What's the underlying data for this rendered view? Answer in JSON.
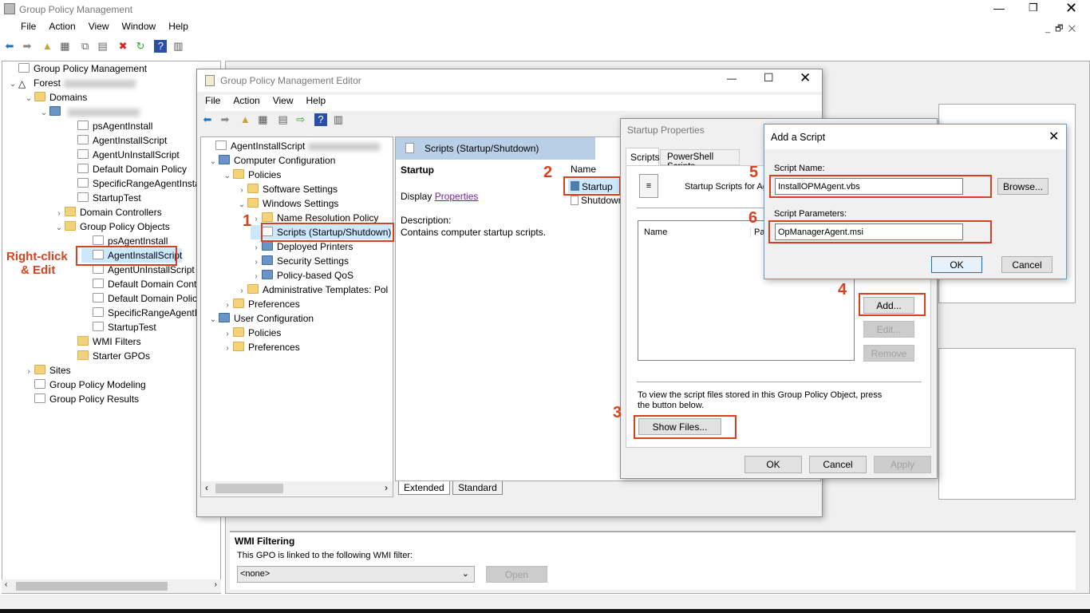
{
  "main": {
    "title": "Group Policy Management",
    "menu": [
      "File",
      "Action",
      "View",
      "Window",
      "Help"
    ],
    "tree": [
      "Group Policy Management",
      "Forest",
      "Domains",
      "",
      "psAgentInstall",
      "AgentInstallScript",
      "AgentUnInstallScript",
      "Default Domain Policy",
      "SpecificRangeAgentInstall",
      "StartupTest",
      "Domain Controllers",
      "Group Policy Objects",
      "psAgentInstall",
      "AgentInstallScript",
      "AgentUnInstallScript",
      "Default Domain Control",
      "Default Domain Policy",
      "SpecificRangeAgentInst",
      "StartupTest",
      "WMI Filters",
      "Starter GPOs",
      "Sites",
      "Group Policy Modeling",
      "Group Policy Results"
    ],
    "wmi": {
      "heading": "WMI Filtering",
      "text": "This GPO is linked to the following WMI filter:",
      "selected": "<none>",
      "open": "Open"
    }
  },
  "editor": {
    "title": "Group Policy Management Editor",
    "menu": [
      "File",
      "Action",
      "View",
      "Help"
    ],
    "tree": [
      "AgentInstallScript",
      "Computer Configuration",
      "Policies",
      "Software Settings",
      "Windows Settings",
      "Name Resolution Policy",
      "Scripts (Startup/Shutdown)",
      "Deployed Printers",
      "Security Settings",
      "Policy-based QoS",
      "Administrative Templates: Pol",
      "Preferences",
      "User Configuration",
      "Policies",
      "Preferences"
    ],
    "header": "Scripts (Startup/Shutdown)",
    "section": "Startup",
    "display": "Display",
    "properties_link": "Properties",
    "desc_label": "Description:",
    "desc": "Contains computer startup scripts.",
    "col_name": "Name",
    "items": [
      "Startup",
      "Shutdown"
    ],
    "tabs": [
      "Extended",
      "Standard"
    ]
  },
  "startup": {
    "title": "Startup Properties",
    "tabs": [
      "Scripts",
      "PowerShell Scripts"
    ],
    "heading": "Startup Scripts for AgentInstallScript",
    "cols": [
      "Name",
      "Parameters"
    ],
    "add": "Add...",
    "edit": "Edit...",
    "remove": "Remove",
    "info": "To view the script files stored in this Group Policy Object, press the button below.",
    "show_files": "Show Files...",
    "ok": "OK",
    "cancel": "Cancel",
    "apply": "Apply"
  },
  "add_script": {
    "title": "Add a Script",
    "name_label": "Script Name:",
    "name_value": "InstallOPMAgent.vbs",
    "browse": "Browse...",
    "params_label": "Script Parameters:",
    "params_value": "OpManagerAgent.msi",
    "ok": "OK",
    "cancel": "Cancel"
  },
  "annotations": {
    "right_click": "Right-click",
    "edit": "& Edit",
    "steps": [
      "1",
      "2",
      "3",
      "4",
      "5",
      "6"
    ]
  },
  "colors": {
    "annotation": "#d9401f",
    "selection": "#cce8ff"
  }
}
